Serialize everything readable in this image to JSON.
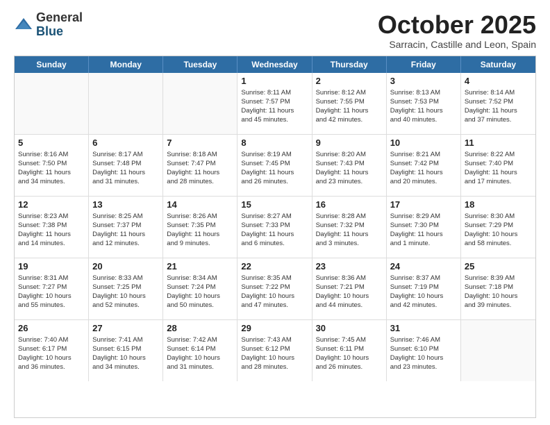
{
  "logo": {
    "general": "General",
    "blue": "Blue"
  },
  "header": {
    "month": "October 2025",
    "location": "Sarracin, Castille and Leon, Spain"
  },
  "weekdays": [
    "Sunday",
    "Monday",
    "Tuesday",
    "Wednesday",
    "Thursday",
    "Friday",
    "Saturday"
  ],
  "weeks": [
    [
      {
        "day": "",
        "info": ""
      },
      {
        "day": "",
        "info": ""
      },
      {
        "day": "",
        "info": ""
      },
      {
        "day": "1",
        "info": "Sunrise: 8:11 AM\nSunset: 7:57 PM\nDaylight: 11 hours\nand 45 minutes."
      },
      {
        "day": "2",
        "info": "Sunrise: 8:12 AM\nSunset: 7:55 PM\nDaylight: 11 hours\nand 42 minutes."
      },
      {
        "day": "3",
        "info": "Sunrise: 8:13 AM\nSunset: 7:53 PM\nDaylight: 11 hours\nand 40 minutes."
      },
      {
        "day": "4",
        "info": "Sunrise: 8:14 AM\nSunset: 7:52 PM\nDaylight: 11 hours\nand 37 minutes."
      }
    ],
    [
      {
        "day": "5",
        "info": "Sunrise: 8:16 AM\nSunset: 7:50 PM\nDaylight: 11 hours\nand 34 minutes."
      },
      {
        "day": "6",
        "info": "Sunrise: 8:17 AM\nSunset: 7:48 PM\nDaylight: 11 hours\nand 31 minutes."
      },
      {
        "day": "7",
        "info": "Sunrise: 8:18 AM\nSunset: 7:47 PM\nDaylight: 11 hours\nand 28 minutes."
      },
      {
        "day": "8",
        "info": "Sunrise: 8:19 AM\nSunset: 7:45 PM\nDaylight: 11 hours\nand 26 minutes."
      },
      {
        "day": "9",
        "info": "Sunrise: 8:20 AM\nSunset: 7:43 PM\nDaylight: 11 hours\nand 23 minutes."
      },
      {
        "day": "10",
        "info": "Sunrise: 8:21 AM\nSunset: 7:42 PM\nDaylight: 11 hours\nand 20 minutes."
      },
      {
        "day": "11",
        "info": "Sunrise: 8:22 AM\nSunset: 7:40 PM\nDaylight: 11 hours\nand 17 minutes."
      }
    ],
    [
      {
        "day": "12",
        "info": "Sunrise: 8:23 AM\nSunset: 7:38 PM\nDaylight: 11 hours\nand 14 minutes."
      },
      {
        "day": "13",
        "info": "Sunrise: 8:25 AM\nSunset: 7:37 PM\nDaylight: 11 hours\nand 12 minutes."
      },
      {
        "day": "14",
        "info": "Sunrise: 8:26 AM\nSunset: 7:35 PM\nDaylight: 11 hours\nand 9 minutes."
      },
      {
        "day": "15",
        "info": "Sunrise: 8:27 AM\nSunset: 7:33 PM\nDaylight: 11 hours\nand 6 minutes."
      },
      {
        "day": "16",
        "info": "Sunrise: 8:28 AM\nSunset: 7:32 PM\nDaylight: 11 hours\nand 3 minutes."
      },
      {
        "day": "17",
        "info": "Sunrise: 8:29 AM\nSunset: 7:30 PM\nDaylight: 11 hours\nand 1 minute."
      },
      {
        "day": "18",
        "info": "Sunrise: 8:30 AM\nSunset: 7:29 PM\nDaylight: 10 hours\nand 58 minutes."
      }
    ],
    [
      {
        "day": "19",
        "info": "Sunrise: 8:31 AM\nSunset: 7:27 PM\nDaylight: 10 hours\nand 55 minutes."
      },
      {
        "day": "20",
        "info": "Sunrise: 8:33 AM\nSunset: 7:25 PM\nDaylight: 10 hours\nand 52 minutes."
      },
      {
        "day": "21",
        "info": "Sunrise: 8:34 AM\nSunset: 7:24 PM\nDaylight: 10 hours\nand 50 minutes."
      },
      {
        "day": "22",
        "info": "Sunrise: 8:35 AM\nSunset: 7:22 PM\nDaylight: 10 hours\nand 47 minutes."
      },
      {
        "day": "23",
        "info": "Sunrise: 8:36 AM\nSunset: 7:21 PM\nDaylight: 10 hours\nand 44 minutes."
      },
      {
        "day": "24",
        "info": "Sunrise: 8:37 AM\nSunset: 7:19 PM\nDaylight: 10 hours\nand 42 minutes."
      },
      {
        "day": "25",
        "info": "Sunrise: 8:39 AM\nSunset: 7:18 PM\nDaylight: 10 hours\nand 39 minutes."
      }
    ],
    [
      {
        "day": "26",
        "info": "Sunrise: 7:40 AM\nSunset: 6:17 PM\nDaylight: 10 hours\nand 36 minutes."
      },
      {
        "day": "27",
        "info": "Sunrise: 7:41 AM\nSunset: 6:15 PM\nDaylight: 10 hours\nand 34 minutes."
      },
      {
        "day": "28",
        "info": "Sunrise: 7:42 AM\nSunset: 6:14 PM\nDaylight: 10 hours\nand 31 minutes."
      },
      {
        "day": "29",
        "info": "Sunrise: 7:43 AM\nSunset: 6:12 PM\nDaylight: 10 hours\nand 28 minutes."
      },
      {
        "day": "30",
        "info": "Sunrise: 7:45 AM\nSunset: 6:11 PM\nDaylight: 10 hours\nand 26 minutes."
      },
      {
        "day": "31",
        "info": "Sunrise: 7:46 AM\nSunset: 6:10 PM\nDaylight: 10 hours\nand 23 minutes."
      },
      {
        "day": "",
        "info": ""
      }
    ]
  ]
}
